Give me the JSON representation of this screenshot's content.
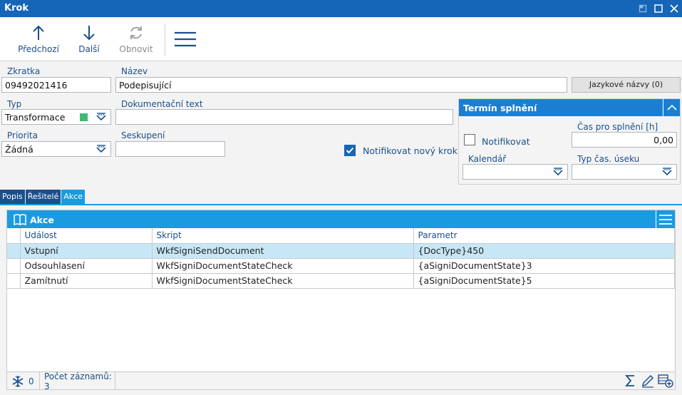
{
  "window": {
    "title": "Krok"
  },
  "toolbar": {
    "prev_label": "Předchozí",
    "next_label": "Další",
    "refresh_label": "Obnovit"
  },
  "form": {
    "zkratka_label": "Zkratka",
    "zkratka_value": "09492021416",
    "nazev_label": "Název",
    "nazev_value": "Podepisující",
    "lang_button": "Jazykové názvy (0)",
    "typ_label": "Typ",
    "typ_value": "Transformace",
    "typ_color": "#3dbb74",
    "dok_label": "Dokumentační text",
    "dok_value": "",
    "priorita_label": "Priorita",
    "priorita_value": "Žádná",
    "seskupeni_label": "Seskupení",
    "seskupeni_value": "",
    "notify_new_label": "Notifikovat nový krok",
    "notify_new_checked": true
  },
  "deadline": {
    "title": "Termín splnění",
    "notify_label": "Notifikovat",
    "notify_checked": false,
    "time_label": "Čas pro splnění [h]",
    "time_value": "0,00",
    "calendar_label": "Kalendář",
    "calendar_value": "",
    "segment_label": "Typ čas. úseku",
    "segment_value": ""
  },
  "tabs": [
    {
      "label": "Popis",
      "active": false
    },
    {
      "label": "Řešitelé",
      "active": false
    },
    {
      "label": "Akce",
      "active": true
    }
  ],
  "grid": {
    "title": "Akce",
    "columns": [
      "Událost",
      "Skript",
      "Parametr"
    ],
    "rows": [
      {
        "cells": [
          "Vstupní",
          "WkfSigniSendDocument",
          "{DocType}450"
        ],
        "selected": true
      },
      {
        "cells": [
          "Odsouhlasení",
          "WkfSigniDocumentStateCheck",
          "{aSigniDocumentState}3"
        ],
        "selected": false
      },
      {
        "cells": [
          "Zamítnutí",
          "WkfSigniDocumentStateCheck",
          "{aSigniDocumentState}5"
        ],
        "selected": false
      }
    ],
    "footer": {
      "filter_count": "0",
      "record_count": "Počet záznamů: 3"
    }
  },
  "colors": {
    "titlebar": "#1565b8",
    "accent": "#1a9be0",
    "selected_row": "#c7e7f7"
  }
}
